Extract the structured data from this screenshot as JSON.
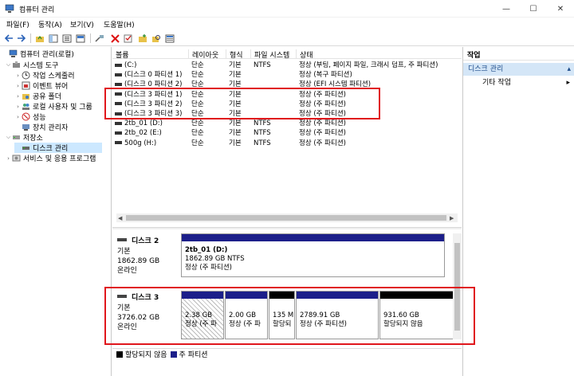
{
  "window": {
    "title": "컴퓨터 관리"
  },
  "menu": [
    "파일(F)",
    "동작(A)",
    "보기(V)",
    "도움말(H)"
  ],
  "tree": {
    "root": "컴퓨터 관리(로컬)",
    "system_tools": "시스템 도구",
    "task_scheduler": "작업 스케줄러",
    "event_viewer": "이벤트 뷰어",
    "shared_folders": "공유 폴더",
    "local_users": "로컬 사용자 및 그룹",
    "performance": "성능",
    "device_manager": "장치 관리자",
    "storage": "저장소",
    "disk_management": "디스크 관리",
    "services": "서비스 및 응용 프로그램"
  },
  "volume_table": {
    "columns": [
      "볼륨",
      "레이아웃",
      "형식",
      "파일 시스템",
      "상태"
    ],
    "rows": [
      {
        "volume": "(C:)",
        "layout": "단순",
        "type": "기본",
        "fs": "NTFS",
        "status": "정상 (부팅, 페이지 파일, 크래시 덤프, 주 파티션)"
      },
      {
        "volume": "(디스크 0 파티션 1)",
        "layout": "단순",
        "type": "기본",
        "fs": "",
        "status": "정상 (복구 파티션)"
      },
      {
        "volume": "(디스크 0 파티션 2)",
        "layout": "단순",
        "type": "기본",
        "fs": "",
        "status": "정상 (EFI 시스템 파티션)"
      },
      {
        "volume": "(디스크 3 파티션 1)",
        "layout": "단순",
        "type": "기본",
        "fs": "",
        "status": "정상 (주 파티션)"
      },
      {
        "volume": "(디스크 3 파티션 2)",
        "layout": "단순",
        "type": "기본",
        "fs": "",
        "status": "정상 (주 파티션)"
      },
      {
        "volume": "(디스크 3 파티션 3)",
        "layout": "단순",
        "type": "기본",
        "fs": "",
        "status": "정상 (주 파티션)"
      },
      {
        "volume": "2tb_01 (D:)",
        "layout": "단순",
        "type": "기본",
        "fs": "NTFS",
        "status": "정상 (주 파티션)"
      },
      {
        "volume": "2tb_02 (E:)",
        "layout": "단순",
        "type": "기본",
        "fs": "NTFS",
        "status": "정상 (주 파티션)"
      },
      {
        "volume": "500g (H:)",
        "layout": "단순",
        "type": "기본",
        "fs": "NTFS",
        "status": "정상 (주 파티션)"
      }
    ]
  },
  "disk2": {
    "name": "디스크 2",
    "kind": "기본",
    "size": "1862.89 GB",
    "state": "온라인",
    "partition": {
      "label": "2tb_01  (D:)",
      "size": "1862.89 GB NTFS",
      "status": "정상 (주 파티션)"
    }
  },
  "disk3": {
    "name": "디스크 3",
    "kind": "기본",
    "size": "3726.02 GB",
    "state": "온라인",
    "partitions": [
      {
        "size": "2.38 GB",
        "status": "정상 (주 파"
      },
      {
        "size": "2.00 GB",
        "status": "정상 (주 파"
      },
      {
        "size": "135 M",
        "status": "할당되"
      },
      {
        "size": "2789.91 GB",
        "status": "정상 (주 파티션)"
      },
      {
        "size": "931.60 GB",
        "status": "할당되지 않음"
      }
    ]
  },
  "legend": {
    "unallocated": "할당되지 않음",
    "primary": "주 파티션"
  },
  "actions": {
    "header": "작업",
    "selected": "디스크 관리",
    "more": "기타 작업"
  },
  "colors": {
    "primary_bar": "#1c1f8a",
    "unallocated_bar": "#000000",
    "highlight": "#e0161c",
    "selection": "#cce8ff"
  }
}
